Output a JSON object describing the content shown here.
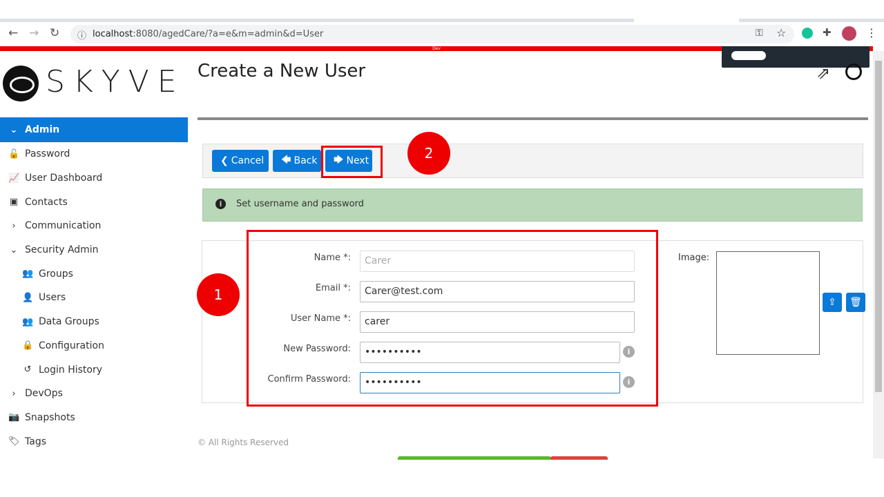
{
  "browser": {
    "url_host": "localhost",
    "url_rest": ":8080/agedCare/?a=e&m=admin&d=User",
    "env_label": "Dev"
  },
  "app": {
    "logo": "SKYVE",
    "page_title": "Create a New User"
  },
  "sidebar": {
    "items": [
      {
        "label": "Admin",
        "icon": "chevron-down-icon",
        "glyph": "⌄"
      },
      {
        "label": "Password",
        "icon": "lock-icon",
        "glyph": "🔓"
      },
      {
        "label": "User Dashboard",
        "icon": "chart-area-icon",
        "glyph": "📈"
      },
      {
        "label": "Contacts",
        "icon": "address-book-icon",
        "glyph": "▣"
      },
      {
        "label": "Communication",
        "icon": "chevron-right-icon",
        "glyph": "›"
      },
      {
        "label": "Security Admin",
        "icon": "chevron-down-icon",
        "glyph": "⌄"
      },
      {
        "label": "Groups",
        "icon": "users-icon",
        "glyph": "👥"
      },
      {
        "label": "Users",
        "icon": "user-icon",
        "glyph": "👤"
      },
      {
        "label": "Data Groups",
        "icon": "users-icon",
        "glyph": "👥"
      },
      {
        "label": "Configuration",
        "icon": "lock-icon",
        "glyph": "🔒"
      },
      {
        "label": "Login History",
        "icon": "history-icon",
        "glyph": "↺"
      },
      {
        "label": "DevOps",
        "icon": "chevron-right-icon",
        "glyph": "›"
      },
      {
        "label": "Snapshots",
        "icon": "camera-icon",
        "glyph": "📷"
      },
      {
        "label": "Tags",
        "icon": "tag-icon",
        "glyph": "🏷"
      }
    ]
  },
  "toolbar": {
    "cancel": "Cancel",
    "back": "Back",
    "next": "Next"
  },
  "annotations": {
    "one": "1",
    "two": "2"
  },
  "message": "Set username and password",
  "form": {
    "name_label": "Name *:",
    "name_placeholder": "Carer",
    "email_label": "Email *:",
    "email_value": "Carer@test.com",
    "username_label": "User Name *:",
    "username_value": "carer",
    "newpw_label": "New Password:",
    "newpw_value": "••••••••••",
    "confirmpw_label": "Confirm Password:",
    "confirmpw_value": "••••••••••",
    "image_label": "Image:"
  },
  "footer": "© All Rights Reserved",
  "colors": {
    "accent": "#0a79d8",
    "annotation": "#e00000",
    "message_bg": "#b8d8b8"
  }
}
